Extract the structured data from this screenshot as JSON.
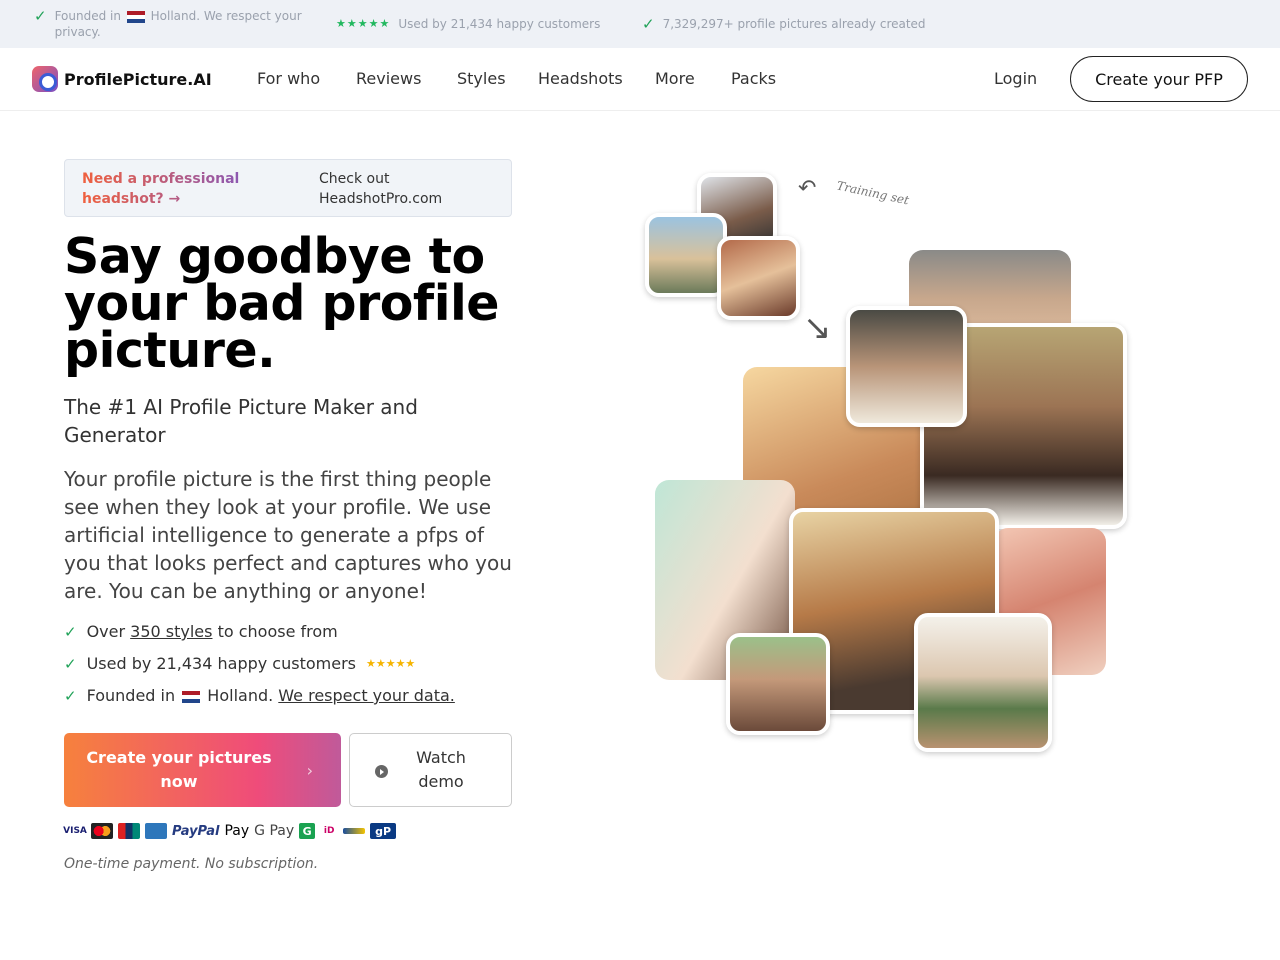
{
  "topbar": {
    "item1": "Founded in",
    "item1b": "Holland. We respect your privacy.",
    "item2": "Used by 21,434 happy customers",
    "item3": "7,329,297+ profile pictures already created",
    "stars": "★★★★★"
  },
  "nav": {
    "logo": "ProfilePicture.AI",
    "links": [
      "For who",
      "Reviews",
      "Styles",
      "Headshots",
      "More",
      "Packs"
    ],
    "login": "Login",
    "cta": "Create your PFP"
  },
  "banner": {
    "left": "Need a professional headshot? →",
    "right": "Check out HeadshotPro.com"
  },
  "hero": {
    "title": "Say goodbye to your bad profile picture.",
    "subtitle": "The #1 AI Profile Picture Maker and Generator",
    "description": "Your profile picture is the first thing people see when they look at your profile. We use artificial intelligence to generate a pfps of you that looks perfect and captures who you are. You can be anything or anyone!"
  },
  "features": {
    "f1_pre": "Over",
    "f1_link": "350 styles",
    "f1_post": "to choose from",
    "f2": "Used by 21,434 happy customers",
    "f2_stars": "★★★★★",
    "f3_pre": "Founded in",
    "f3_mid": "Holland.",
    "f3_link": "We respect your data."
  },
  "buttons": {
    "primary": "Create your pictures now",
    "chevron": "›",
    "secondary": "Watch demo"
  },
  "payments": [
    "VISA",
    "PayPal",
    "Pay",
    "G Pay",
    "G",
    "iD",
    "gP"
  ],
  "note": "One-time payment. No subscription.",
  "gallery": {
    "training_label": "Training set"
  },
  "colors": {
    "accent_start": "#f6813d",
    "accent_end": "#c05a9a",
    "check": "#22a35a"
  }
}
